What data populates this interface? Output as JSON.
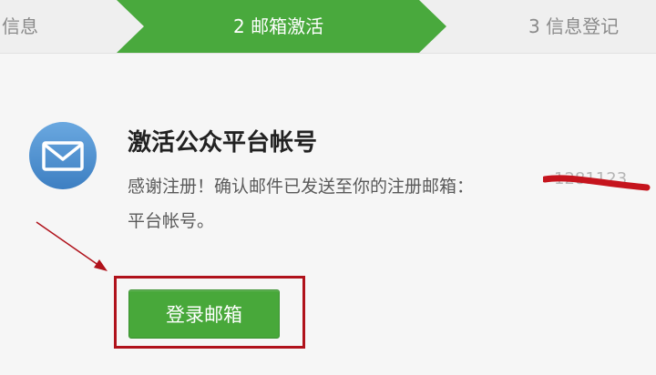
{
  "steps": [
    {
      "label": "信息",
      "state": "done"
    },
    {
      "label": "2 邮箱激活",
      "state": "active"
    },
    {
      "label": "3 信息登记",
      "state": "pending"
    }
  ],
  "colors": {
    "active_step": "#49a93d",
    "inactive_step": "#efefef",
    "button": "#48a83a",
    "highlight": "#b0121b",
    "icon": "#4a8fd0"
  },
  "activation": {
    "icon": "envelope-icon",
    "title": "激活公众平台帐号",
    "message_line1": "感谢注册！确认邮件已发送至你的注册邮箱：",
    "message_line2": "平台帐号。"
  },
  "login_button": {
    "label": "登录邮箱"
  }
}
